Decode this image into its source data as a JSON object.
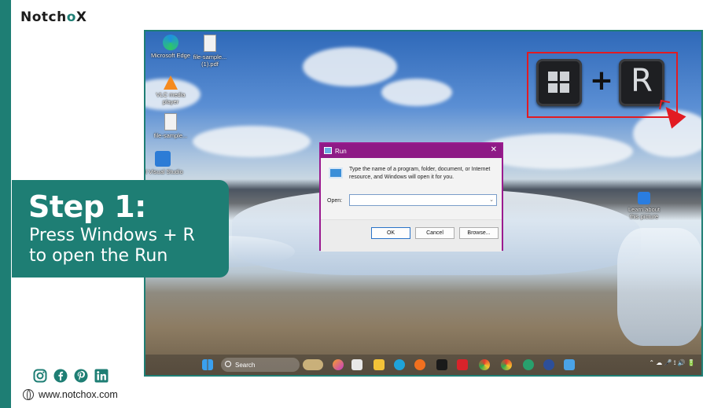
{
  "brand": {
    "logo_main": "Notch",
    "logo_o": "o",
    "logo_x": "X",
    "accent_color": "#1e7e74"
  },
  "desktop": {
    "icons": [
      {
        "label": "Microsoft Edge"
      },
      {
        "label": "file-sample... (1).pdf"
      },
      {
        "label": "VLC media player"
      },
      {
        "label": "file-sample..."
      },
      {
        "label": "el Visual Studio"
      },
      {
        "label": "Learn about this picture"
      }
    ]
  },
  "run_dialog": {
    "title": "Run",
    "close": "✕",
    "description": "Type the name of a program, folder, document, or Internet resource, and Windows will open it for you.",
    "open_label": "Open:",
    "open_value": "",
    "ok_label": "OK",
    "cancel_label": "Cancel",
    "browse_label": "Browse..."
  },
  "shortcut": {
    "plus": "+",
    "key_r": "R"
  },
  "taskbar": {
    "search_label": "Search"
  },
  "step": {
    "heading": "Step 1:",
    "line1": "Press Windows + R",
    "line2": "to open the Run"
  },
  "footer": {
    "website": "www.notchox.com"
  }
}
